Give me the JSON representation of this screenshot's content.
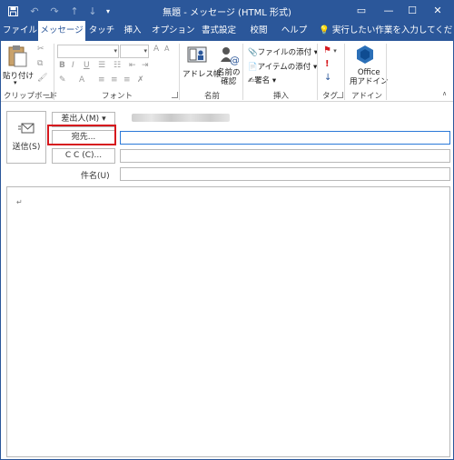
{
  "title": "無題 - メッセージ (HTML 形式)",
  "window_buttons": {
    "ribbon_options": "▭",
    "minimize": "—",
    "maximize": "☐",
    "close": "✕"
  },
  "tabs": [
    {
      "label": "ファイル",
      "active": false
    },
    {
      "label": "メッセージ",
      "active": true
    },
    {
      "label": "タッチ",
      "active": false
    },
    {
      "label": "挿入",
      "active": false
    },
    {
      "label": "オプション",
      "active": false
    },
    {
      "label": "書式設定",
      "active": false
    },
    {
      "label": "校閲",
      "active": false
    },
    {
      "label": "ヘルプ",
      "active": false
    }
  ],
  "tell_me": "実行したい作業を入力してください",
  "ribbon": {
    "clipboard": {
      "paste": "貼り付け",
      "label": "クリップボード"
    },
    "font": {
      "bold": "B",
      "italic": "I",
      "underline": "U",
      "label": "フォント"
    },
    "names": {
      "address_book": "アドレス帳",
      "check_names": "名前の\n確認",
      "label": "名前"
    },
    "include": {
      "attach_file": "ファイルの添付",
      "attach_item": "アイテムの添付",
      "signature": "署名",
      "label": "挿入"
    },
    "tags": {
      "label": "タグ"
    },
    "addins": {
      "office_addins": "Office\n用アドイン",
      "label": "アドイン"
    }
  },
  "compose": {
    "send": "送信(S)",
    "from": "差出人(M)",
    "to": "宛先...",
    "cc": "C C (C)...",
    "subject_label": "件名(U)",
    "body_mark": "↵"
  },
  "colors": {
    "accent": "#2b579a",
    "highlight": "#d6191e"
  }
}
